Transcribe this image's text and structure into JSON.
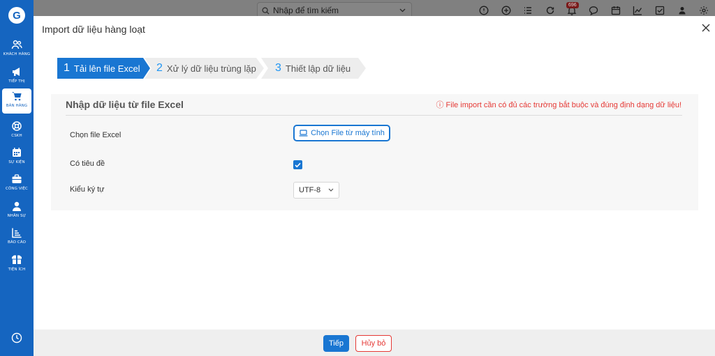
{
  "app": {
    "logo_icon": "app-logo-icon",
    "brand_color": "#1565c0",
    "accent_color": "#1976d2",
    "danger_color": "#e53935"
  },
  "sidebar": {
    "items": [
      {
        "label": "KHÁCH HÀNG",
        "icon": "users-icon",
        "active": false
      },
      {
        "label": "TIẾP THỊ",
        "icon": "megaphone-icon",
        "active": false
      },
      {
        "label": "BÁN HÀNG",
        "icon": "cart-icon",
        "active": true
      },
      {
        "label": "CSKH",
        "icon": "lifebuoy-icon",
        "active": false
      },
      {
        "label": "SỰ KIỆN",
        "icon": "calendar-icon",
        "active": false
      },
      {
        "label": "CÔNG VIỆC",
        "icon": "briefcase-icon",
        "active": false
      },
      {
        "label": "NHÂN SỰ",
        "icon": "person-icon",
        "active": false
      },
      {
        "label": "BÁO CÁO",
        "icon": "report-icon",
        "active": false
      },
      {
        "label": "TIỆN ÍCH",
        "icon": "box-icon",
        "active": false
      }
    ]
  },
  "topbar": {
    "search_placeholder": "Nhập để tìm kiếm",
    "notification_count": "696"
  },
  "modal": {
    "title": "Import dữ liệu hàng loạt",
    "steps": [
      {
        "number": "1",
        "label": "Tải lên file Excel",
        "active": true
      },
      {
        "number": "2",
        "label": "Xử lý dữ liệu trùng lặp",
        "active": false
      },
      {
        "number": "3",
        "label": "Thiết lập dữ liệu",
        "active": false
      }
    ],
    "panel": {
      "title": "Nhập dữ liệu từ file Excel",
      "warning": "ⓘ File import cần có đủ các trường bắt buộc và đúng định dạng dữ liệu!",
      "file_label": "Chọn file Excel",
      "file_button": "Chọn File từ máy tính",
      "header_label": "Có tiêu đề",
      "header_checked": true,
      "encoding_label": "Kiểu ký tự",
      "encoding_value": "UTF-8"
    },
    "footer": {
      "next_label": "Tiếp",
      "cancel_label": "Hủy bỏ"
    }
  }
}
